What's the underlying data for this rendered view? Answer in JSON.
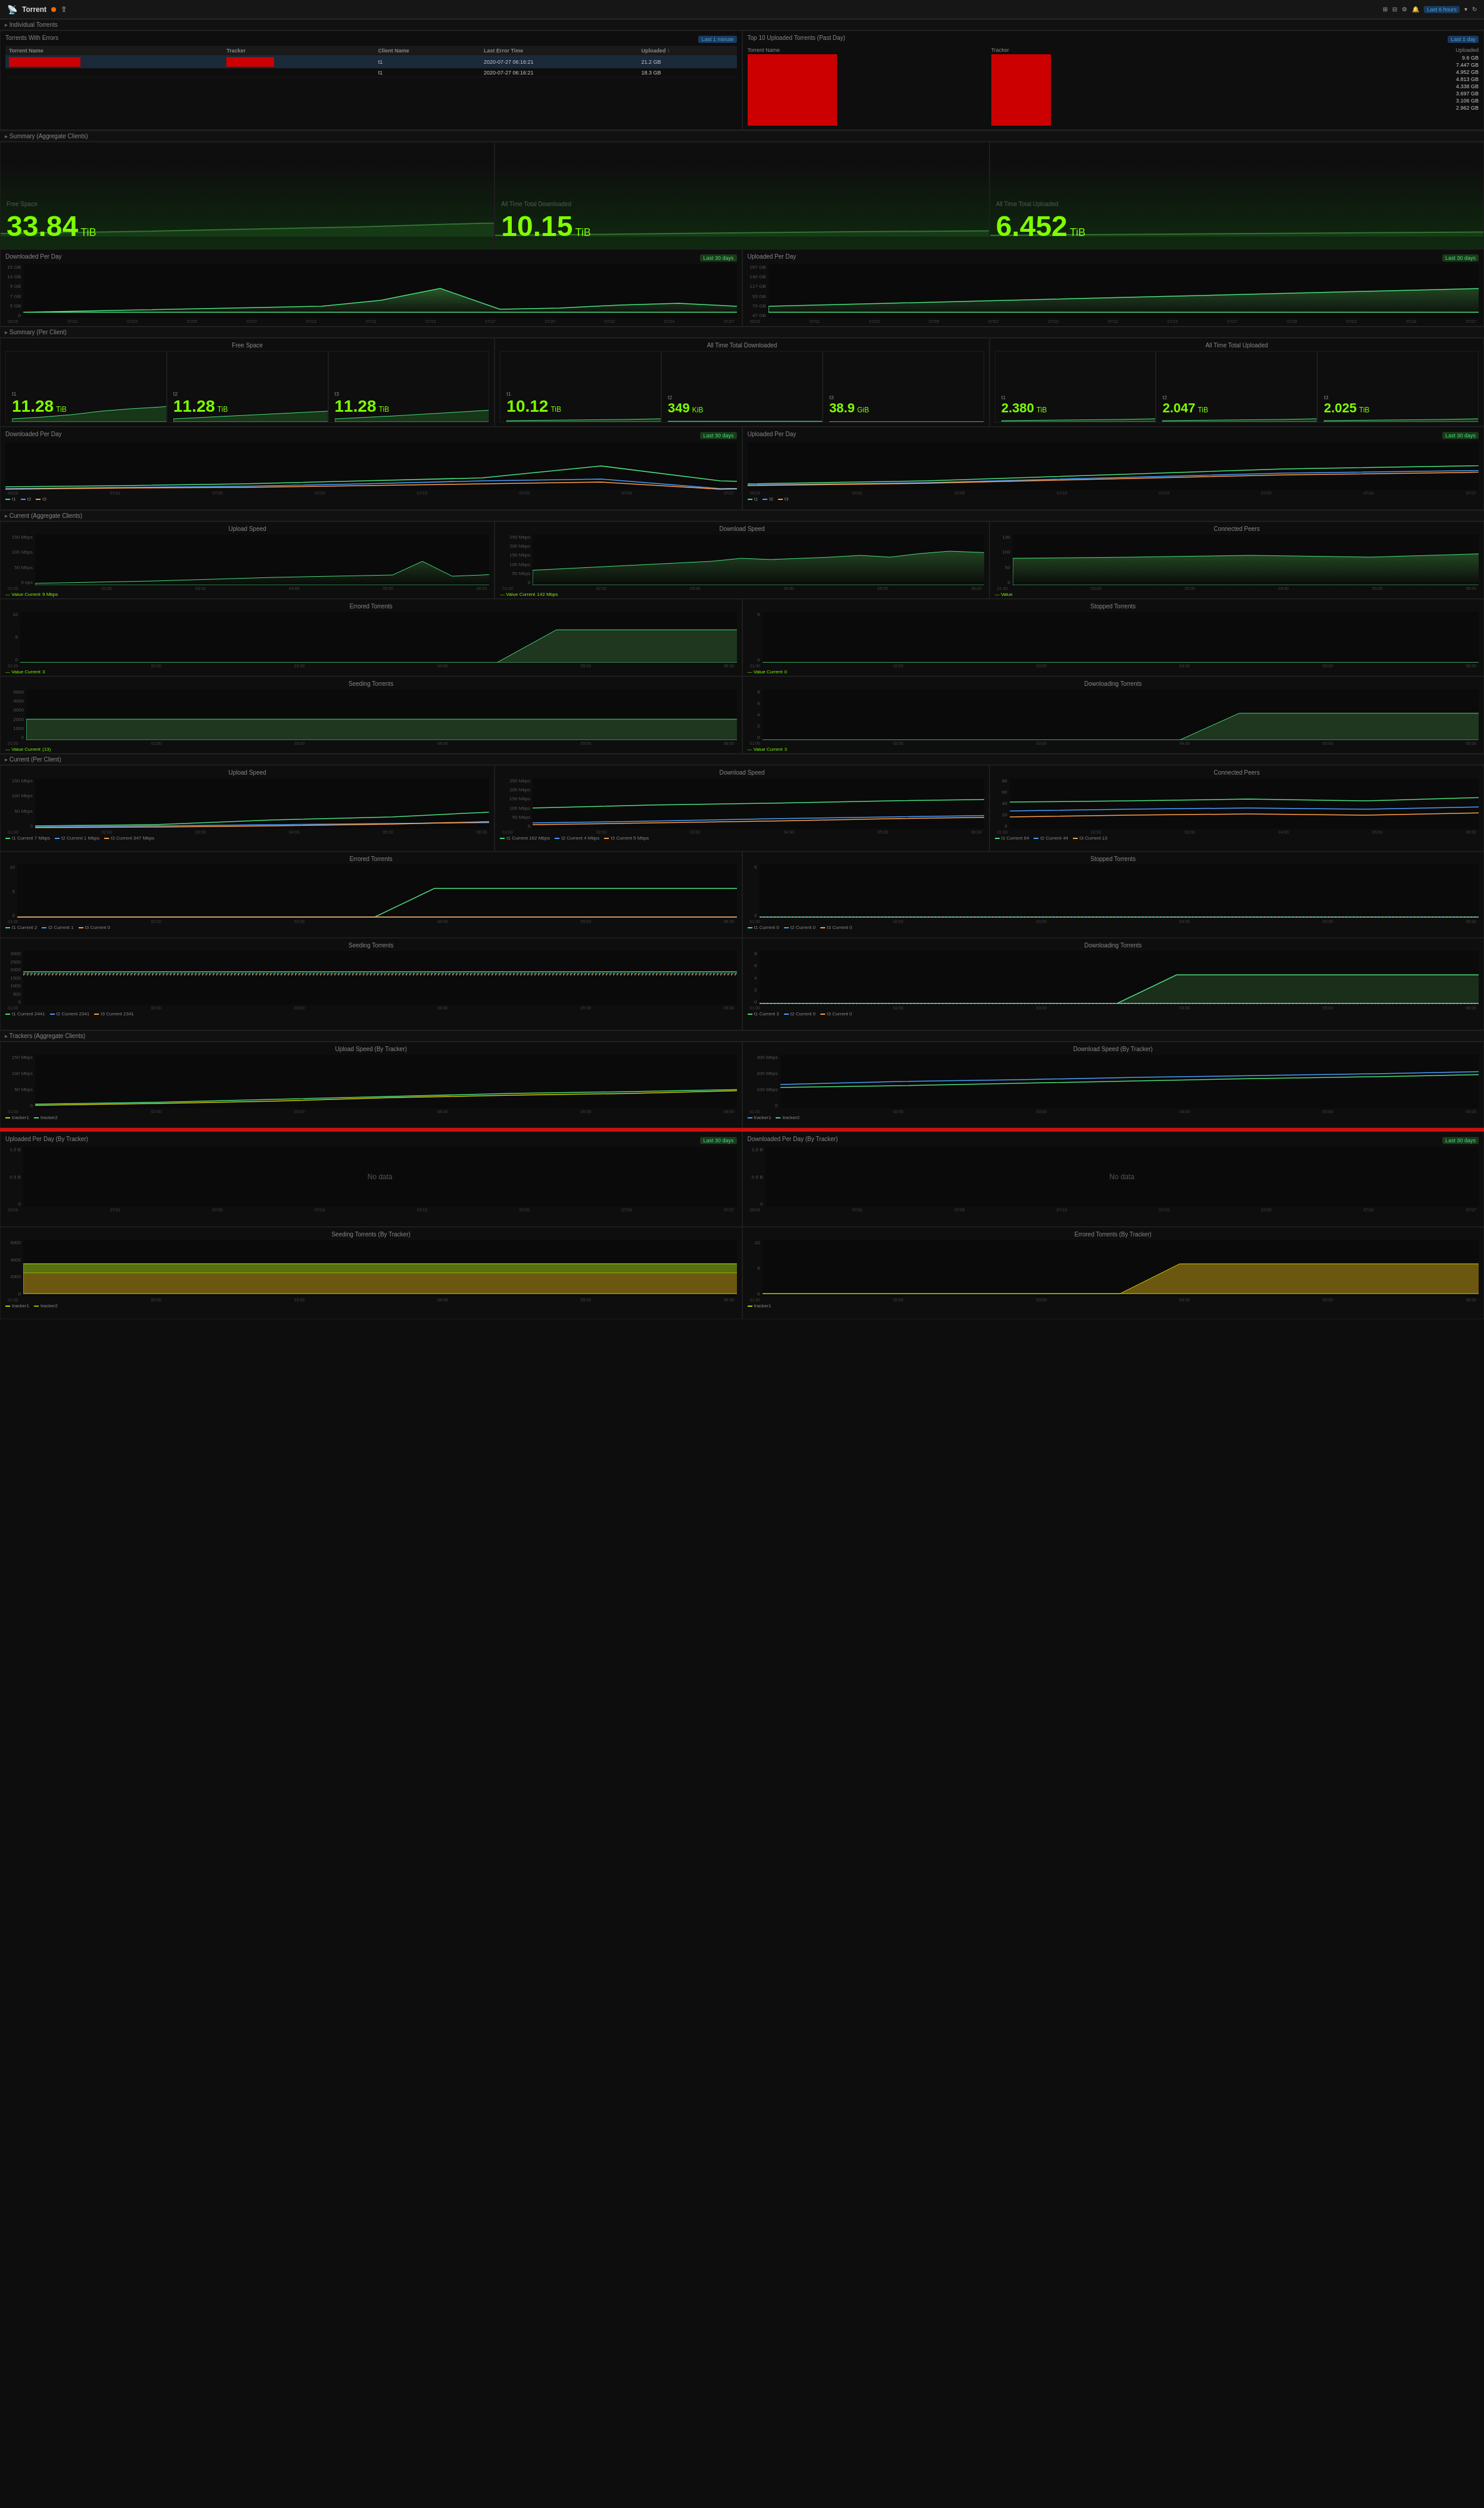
{
  "app": {
    "title": "Torrent",
    "timeRange": "Last 6 hours",
    "icons": [
      "share",
      "settings",
      "clock",
      "refresh"
    ]
  },
  "sections": {
    "individual": "Individual Torrents",
    "summaryAggregate": "Summary (Aggregate Clients)",
    "summaryPerClient": "Summary (Per Client)",
    "currentAggregate": "Current (Aggregate Clients)",
    "currentPerClient": "Current (Per Client)",
    "trackersAggregate": "Trackers (Aggregate Clients)"
  },
  "torrentsWithErrors": {
    "title": "Torrents With Errors",
    "badge": "Last 1 minute",
    "columns": [
      "Torrent Name",
      "Tracker",
      "Client Name",
      "Last Error Time",
      "Uploaded ↑"
    ],
    "rows": [
      {
        "name": "",
        "tracker": "",
        "client": "t1",
        "time": "2020-07-27 06:16:21",
        "uploaded": "21.2 GB"
      },
      {
        "name": "",
        "tracker": "",
        "client": "t1",
        "time": "2020-07-27 06:16:21",
        "uploaded": "18.3 GB"
      }
    ]
  },
  "top10Uploaded": {
    "title": "Top 10 Uploaded Torrents (Past Day)",
    "badge": "Last 1 day",
    "columns": [
      "Torrent Name",
      "Tracker",
      "Uploaded"
    ],
    "values": [
      "9.6 GB",
      "7.447 GB",
      "4.952 GB",
      "4.813 GB",
      "4.338 GB",
      "3.697 GB",
      "3.106 GB",
      "2.962 GB"
    ]
  },
  "summaryAggregate": {
    "freeSpace": {
      "title": "Free Space",
      "value": "33.84",
      "unit": "TiB"
    },
    "totalDownloaded": {
      "title": "All Time Total Downloaded",
      "value": "10.15",
      "unit": "TiB"
    },
    "totalUploaded": {
      "title": "All Time Total Uploaded",
      "value": "6.452",
      "unit": "TiB"
    },
    "downloadedPerDay": {
      "title": "Downloaded Per Day",
      "badge": "Last 30 days",
      "yLabels": [
        "15 GB",
        "14 GB",
        "9 GB",
        "7 GB",
        "5 GB",
        "0"
      ]
    },
    "uploadedPerDay": {
      "title": "Uploaded Per Day",
      "badge": "Last 30 days",
      "yLabels": [
        "167 GB",
        "140 GB",
        "117 GB",
        "93 GB",
        "70 GB",
        "47 GB"
      ]
    },
    "xLabels": [
      "06/29",
      "07/01",
      "07/03",
      "07/05",
      "07/07",
      "07/10",
      "07/12",
      "07/15",
      "07/17",
      "07/20",
      "07/22",
      "07/24",
      "07/27"
    ]
  },
  "summaryPerClient": {
    "freeSpace": {
      "title": "Free Space",
      "clients": [
        {
          "name": "t1",
          "value": "11.28",
          "unit": "TiB"
        },
        {
          "name": "t2",
          "value": "11.28",
          "unit": "TiB"
        },
        {
          "name": "t3",
          "value": "11.28",
          "unit": "TiB"
        }
      ]
    },
    "totalDownloaded": {
      "title": "All Time Total Downloaded",
      "clients": [
        {
          "name": "t1",
          "value": "10.12",
          "unit": "TiB"
        },
        {
          "name": "t2",
          "value": "349",
          "unit": "KiB"
        },
        {
          "name": "t3",
          "value": "38.9",
          "unit": "GiB"
        }
      ]
    },
    "totalUploaded": {
      "title": "All Time Total Uploaded",
      "clients": [
        {
          "name": "t1",
          "value": "2.380",
          "unit": "TiB"
        },
        {
          "name": "t2",
          "value": "2.047",
          "unit": "TiB"
        },
        {
          "name": "t3",
          "value": "2.025",
          "unit": "TiB"
        }
      ]
    },
    "downloadedPerDay": {
      "title": "Downloaded Per Day",
      "badge": "Last 30 days"
    },
    "uploadedPerDay": {
      "title": "Uploaded Per Day",
      "badge": "Last 30 days"
    },
    "legends": {
      "downloaded": [
        "t1",
        "t2",
        "t3"
      ],
      "uploaded": [
        "t1",
        "t2",
        "t3"
      ]
    }
  },
  "currentAggregate": {
    "uploadSpeed": {
      "title": "Upload Speed",
      "current": "9 Mbps",
      "yLabels": [
        "150 Mbps",
        "100 Mbps",
        "50 Mbps",
        "0 bps"
      ]
    },
    "downloadSpeed": {
      "title": "Download Speed",
      "current": "142 Mbps",
      "yLabels": [
        "250 Mbps",
        "200 Mbps",
        "150 Mbps",
        "100 Mbps",
        "50 Mbps",
        "0"
      ]
    },
    "connectedPeers": {
      "title": "Connected Peers",
      "yLabels": [
        "130",
        "100",
        "50",
        "0"
      ]
    },
    "erroredTorrents": {
      "title": "Errored Torrents",
      "current": "3"
    },
    "stoppedTorrents": {
      "title": "Stopped Torrents",
      "current": "0"
    },
    "seedingTorrents": {
      "title": "Seeding Torrents",
      "current": "(13)"
    },
    "downloadingTorrents": {
      "title": "Downloading Torrents",
      "current": "3"
    },
    "xLabels": [
      "01:00",
      "02:00",
      "03:00",
      "04:00",
      "05:00",
      "06:00"
    ]
  },
  "currentPerClient": {
    "uploadSpeed": {
      "title": "Upload Speed",
      "legends": [
        "t1 Current 7 Mbps",
        "t2 Current 1 Mbps",
        "t3 Current 347 Mbps"
      ]
    },
    "downloadSpeed": {
      "title": "Download Speed",
      "legends": [
        "t1 Current 162 Mbps",
        "t2 Current 4 Mbps",
        "t3 Current 5 Mbps"
      ]
    },
    "connectedPeers": {
      "title": "Connected Peers",
      "legends": [
        "t1 Current 64",
        "t2 Current 44",
        "t3 Current 13"
      ]
    },
    "erroredTorrents": {
      "title": "Errored Torrents",
      "legends": [
        "t1 Current 2",
        "t2 Current 1",
        "t3 Current 0"
      ]
    },
    "stoppedTorrents": {
      "title": "Stopped Torrents",
      "legends": [
        "t1 Current 0",
        "t2 Current 0",
        "t3 Current 0"
      ]
    },
    "seedingTorrents": {
      "title": "Seeding Torrents",
      "legends": [
        "t1 Current 2441",
        "t2 Current 2341",
        "t3 Current 2341"
      ]
    },
    "downloadingTorrents": {
      "title": "Downloading Torrents",
      "legends": [
        "t1 Current 3",
        "t2 Current 0",
        "t3 Current 0"
      ]
    }
  },
  "trackersAggregate": {
    "uploadSpeedByTracker": {
      "title": "Upload Speed (By Tracker)",
      "yLabels": [
        "150 Mbps",
        "100 Mbps",
        "50 Mbps",
        "0"
      ]
    },
    "downloadSpeedByTracker": {
      "title": "Download Speed (By Tracker)",
      "yLabels": [
        "300 Mbps",
        "200 Mbps",
        "100 Mbps",
        "0"
      ]
    },
    "uploadedPerDayByTracker": {
      "title": "Uploaded Per Day (By Tracker)",
      "badge": "Last 30 days",
      "note": "No data"
    },
    "downloadedPerDayByTracker": {
      "title": "Downloaded Per Day (By Tracker)",
      "badge": "Last 30 days",
      "note": "No data"
    },
    "seedingByTracker": {
      "title": "Seeding Torrents (By Tracker)"
    },
    "erroredByTracker": {
      "title": "Errored Torrents (By Tracker)"
    },
    "xLabels": [
      "01:00",
      "02:00",
      "03:00",
      "04:00",
      "05:00",
      "06:00"
    ]
  },
  "colors": {
    "green": "#7fff00",
    "darkGreen": "#1a3a1a",
    "chartLine": "#4adf7f",
    "chartLine2": "#4a9fff",
    "chartLine3": "#ff9f4a",
    "red": "#cc1111",
    "bg": "#0d0d0d",
    "panel": "#0e0e0e",
    "border": "#1e1e1e"
  }
}
